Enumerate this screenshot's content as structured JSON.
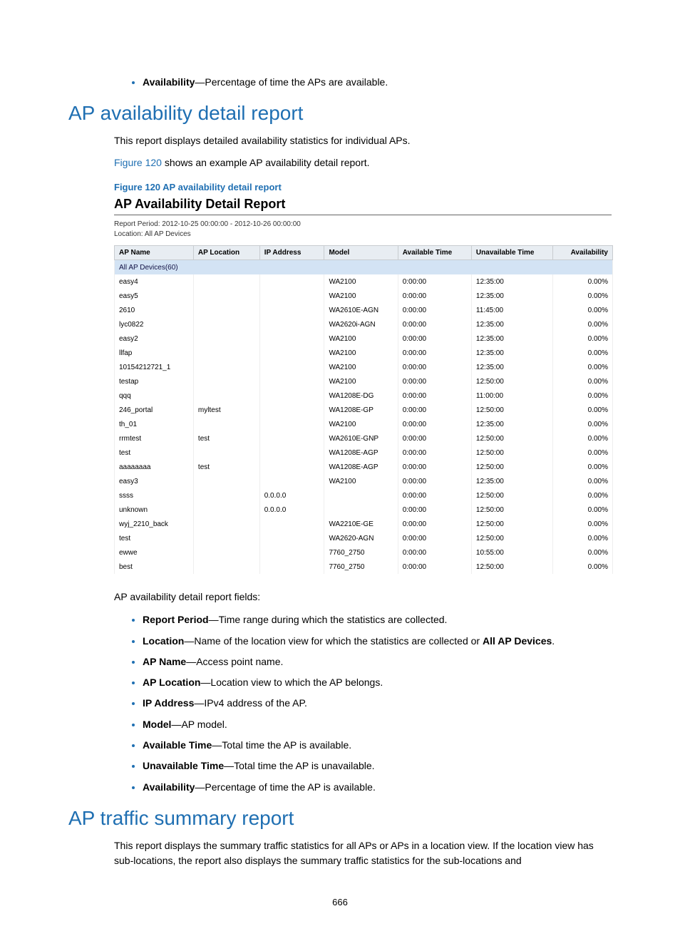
{
  "top_bullet": {
    "term": "Availability",
    "desc": "—Percentage of time the APs are available."
  },
  "section1": {
    "heading": "AP availability detail report",
    "para1": "This report displays detailed availability statistics for individual APs.",
    "para2a": "Figure 120",
    "para2b": " shows an example AP availability detail report.",
    "fig_caption": "Figure 120 AP availability detail report",
    "report_title": "AP Availability Detail Report",
    "report_period": "Report Period: 2012-10-25 00:00:00  -  2012-10-26 00:00:00",
    "report_location": "Location: All AP Devices",
    "columns": [
      "AP Name",
      "AP  Location",
      "IP Address",
      "Model",
      "Available Time",
      "Unavailable Time",
      "Availability"
    ],
    "group_label": "All AP Devices(60)",
    "rows": [
      {
        "name": "easy4",
        "loc": "",
        "ip": "",
        "model": "WA2100",
        "avail": "0:00:00",
        "unavail": "12:35:00",
        "pct": "0.00%"
      },
      {
        "name": "easy5",
        "loc": "",
        "ip": "",
        "model": "WA2100",
        "avail": "0:00:00",
        "unavail": "12:35:00",
        "pct": "0.00%"
      },
      {
        "name": "2610",
        "loc": "",
        "ip": "",
        "model": "WA2610E-AGN",
        "avail": "0:00:00",
        "unavail": "11:45:00",
        "pct": "0.00%"
      },
      {
        "name": "lyc0822",
        "loc": "",
        "ip": "",
        "model": "WA2620i-AGN",
        "avail": "0:00:00",
        "unavail": "12:35:00",
        "pct": "0.00%"
      },
      {
        "name": "easy2",
        "loc": "",
        "ip": "",
        "model": "WA2100",
        "avail": "0:00:00",
        "unavail": "12:35:00",
        "pct": "0.00%"
      },
      {
        "name": "llfap",
        "loc": "",
        "ip": "",
        "model": "WA2100",
        "avail": "0:00:00",
        "unavail": "12:35:00",
        "pct": "0.00%"
      },
      {
        "name": "10154212721_1",
        "loc": "",
        "ip": "",
        "model": "WA2100",
        "avail": "0:00:00",
        "unavail": "12:35:00",
        "pct": "0.00%"
      },
      {
        "name": "testap",
        "loc": "",
        "ip": "",
        "model": "WA2100",
        "avail": "0:00:00",
        "unavail": "12:50:00",
        "pct": "0.00%"
      },
      {
        "name": "qqq",
        "loc": "",
        "ip": "",
        "model": "WA1208E-DG",
        "avail": "0:00:00",
        "unavail": "11:00:00",
        "pct": "0.00%"
      },
      {
        "name": "246_portal",
        "loc": "myltest",
        "ip": "",
        "model": "WA1208E-GP",
        "avail": "0:00:00",
        "unavail": "12:50:00",
        "pct": "0.00%"
      },
      {
        "name": "th_01",
        "loc": "",
        "ip": "",
        "model": "WA2100",
        "avail": "0:00:00",
        "unavail": "12:35:00",
        "pct": "0.00%"
      },
      {
        "name": "rrmtest",
        "loc": "test",
        "ip": "",
        "model": "WA2610E-GNP",
        "avail": "0:00:00",
        "unavail": "12:50:00",
        "pct": "0.00%"
      },
      {
        "name": "test",
        "loc": "",
        "ip": "",
        "model": "WA1208E-AGP",
        "avail": "0:00:00",
        "unavail": "12:50:00",
        "pct": "0.00%"
      },
      {
        "name": "aaaaaaaa",
        "loc": "test",
        "ip": "",
        "model": "WA1208E-AGP",
        "avail": "0:00:00",
        "unavail": "12:50:00",
        "pct": "0.00%"
      },
      {
        "name": "easy3",
        "loc": "",
        "ip": "",
        "model": "WA2100",
        "avail": "0:00:00",
        "unavail": "12:35:00",
        "pct": "0.00%"
      },
      {
        "name": "ssss",
        "loc": "",
        "ip": "0.0.0.0",
        "model": "",
        "avail": "0:00:00",
        "unavail": "12:50:00",
        "pct": "0.00%"
      },
      {
        "name": "unknown",
        "loc": "",
        "ip": "0.0.0.0",
        "model": "",
        "avail": "0:00:00",
        "unavail": "12:50:00",
        "pct": "0.00%"
      },
      {
        "name": "wyj_2210_back",
        "loc": "",
        "ip": "",
        "model": "WA2210E-GE",
        "avail": "0:00:00",
        "unavail": "12:50:00",
        "pct": "0.00%"
      },
      {
        "name": "test",
        "loc": "",
        "ip": "",
        "model": "WA2620-AGN",
        "avail": "0:00:00",
        "unavail": "12:50:00",
        "pct": "0.00%"
      },
      {
        "name": "ewwe",
        "loc": "",
        "ip": "",
        "model": "7760_2750",
        "avail": "0:00:00",
        "unavail": "10:55:00",
        "pct": "0.00%"
      },
      {
        "name": "best",
        "loc": "",
        "ip": "",
        "model": "7760_2750",
        "avail": "0:00:00",
        "unavail": "12:50:00",
        "pct": "0.00%"
      }
    ],
    "fields_intro": "AP availability detail report fields:",
    "fields": [
      {
        "term": "Report Period",
        "desc": "—Time range during which the statistics are collected."
      },
      {
        "term": "Location",
        "desc": "—Name of the location view for which the statistics are collected or ",
        "desc_bold": "All AP Devices",
        "desc_after": "."
      },
      {
        "term": "AP Name",
        "desc": "—Access point name."
      },
      {
        "term": "AP Location",
        "desc": "—Location view to which the AP belongs."
      },
      {
        "term": "IP Address",
        "desc": "—IPv4 address of the AP."
      },
      {
        "term": "Model",
        "desc": "—AP model."
      },
      {
        "term": "Available Time",
        "desc": "—Total time the AP is available."
      },
      {
        "term": "Unavailable Time",
        "desc": "—Total time the AP is unavailable."
      },
      {
        "term": "Availability",
        "desc": "—Percentage of time the AP is available."
      }
    ]
  },
  "section2": {
    "heading": "AP traffic summary report",
    "para1": "This report displays the summary traffic statistics for all APs or APs in a location view. If the location view has sub-locations, the report also displays the summary traffic statistics for the sub-locations and"
  },
  "pagenum": "666"
}
